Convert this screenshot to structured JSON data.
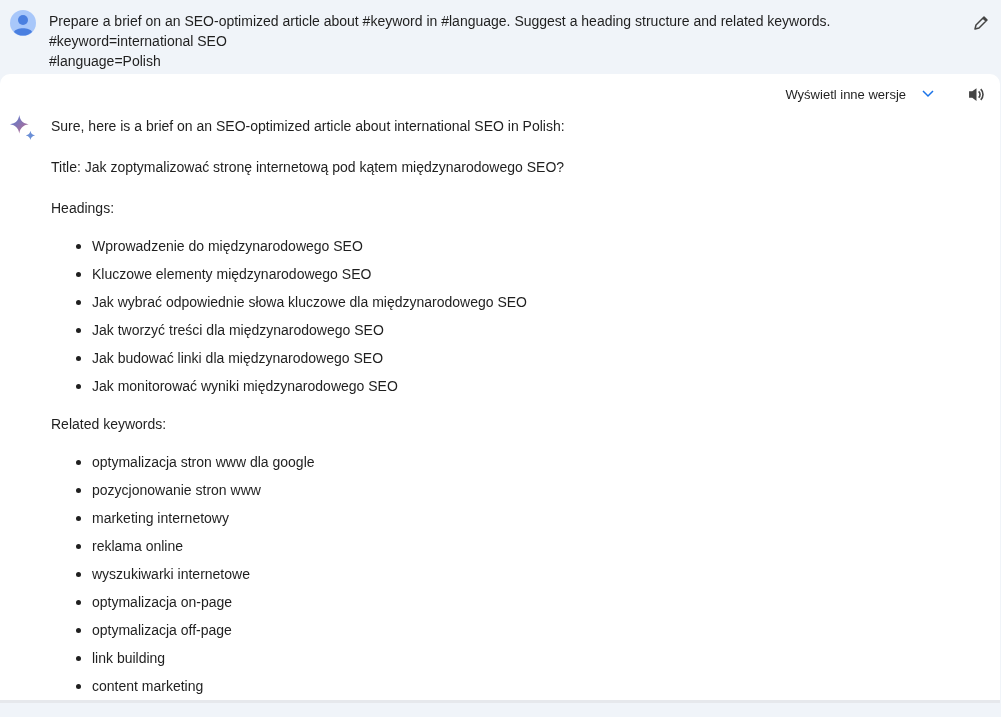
{
  "prompt": {
    "lines": [
      "Prepare a brief on an SEO-optimized article about #keyword in #language. Suggest a heading structure and related keywords.",
      "#keyword=international SEO",
      "#language=Polish"
    ]
  },
  "response": {
    "versions_label": "Wyświetl inne wersje",
    "intro": "Sure, here is a brief on an SEO-optimized article about international SEO in Polish:",
    "title": "Title: Jak zoptymalizować stronę internetową pod kątem międzynarodowego SEO?",
    "sections": [
      {
        "heading": "Headings:",
        "items": [
          "Wprowadzenie do międzynarodowego SEO",
          "Kluczowe elementy międzynarodowego SEO",
          "Jak wybrać odpowiednie słowa kluczowe dla międzynarodowego SEO",
          "Jak tworzyć treści dla międzynarodowego SEO",
          "Jak budować linki dla międzynarodowego SEO",
          "Jak monitorować wyniki międzynarodowego SEO"
        ]
      },
      {
        "heading": "Related keywords:",
        "items": [
          "optymalizacja stron www dla google",
          "pozycjonowanie stron www",
          "marketing internetowy",
          "reklama online",
          "wyszukiwarki internetowe",
          "optymalizacja on-page",
          "optymalizacja off-page",
          "link building",
          "content marketing"
        ]
      }
    ]
  }
}
